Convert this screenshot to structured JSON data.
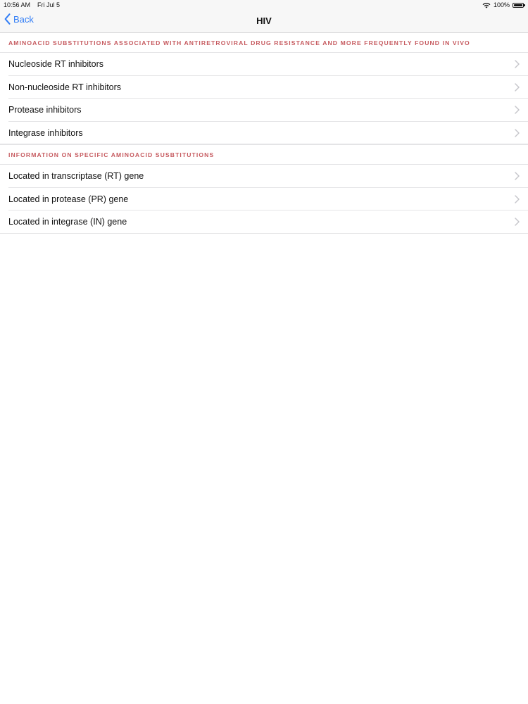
{
  "status_bar": {
    "time": "10:56 AM",
    "date": "Fri Jul 5",
    "battery": "100%",
    "wifi_icon": "wifi-icon",
    "battery_icon": "battery-icon"
  },
  "nav": {
    "back_label": "Back",
    "back_icon": "chevron-left-icon",
    "title": "HIV"
  },
  "sections": [
    {
      "header": "AMINOACID SUBSTITUTIONS ASSOCIATED WITH ANTIRETROVIRAL DRUG RESISTANCE AND MORE FREQUENTLY FOUND IN VIVO",
      "items": [
        {
          "label": "Nucleoside RT inhibitors"
        },
        {
          "label": "Non-nucleoside RT inhibitors"
        },
        {
          "label": "Protease inhibitors"
        },
        {
          "label": "Integrase inhibitors"
        }
      ]
    },
    {
      "header": "INFORMATION ON SPECIFIC AMINOACID SUSBTITUTIONS",
      "items": [
        {
          "label": "Located in transcriptase (RT) gene"
        },
        {
          "label": "Located in protease (PR) gene"
        },
        {
          "label": "Located in integrase (IN) gene"
        }
      ]
    }
  ],
  "colors": {
    "accent": "#2f7cf6",
    "section_header": "#c65a5f",
    "separator": "#e4e4e6",
    "nav_background": "#f7f7f7"
  }
}
